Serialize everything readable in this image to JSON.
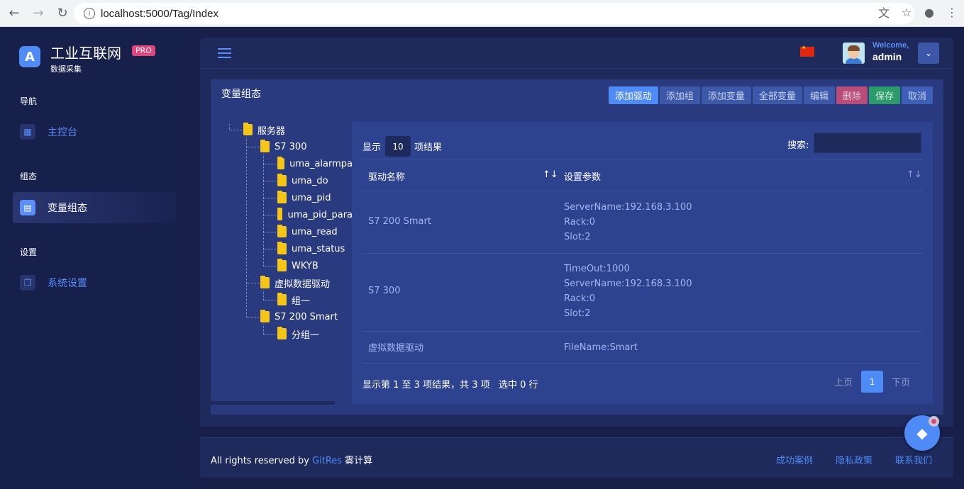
{
  "browser": {
    "url": "localhost:5000/Tag/Index"
  },
  "brand": {
    "title": "工业互联网",
    "subtitle": "数据采集",
    "badge": "PRO"
  },
  "sidebar": {
    "sections": [
      {
        "label": "导航"
      },
      {
        "label": "组态"
      },
      {
        "label": "设置"
      }
    ],
    "items": [
      {
        "label": "主控台",
        "icon": "dashboard-icon",
        "active": false
      },
      {
        "label": "变量组态",
        "icon": "window-icon",
        "active": true
      },
      {
        "label": "系统设置",
        "icon": "copy-icon",
        "active": false
      }
    ]
  },
  "topbar": {
    "welcome": "Welcome,",
    "username": "admin",
    "flag": "china-flag-icon"
  },
  "card": {
    "title": "变量组态",
    "toolbar": [
      "添加驱动",
      "添加组",
      "添加变量",
      "全部变量",
      "编辑",
      "删除",
      "保存",
      "取消"
    ]
  },
  "tree": {
    "nodes": [
      "服务器",
      "S7 300",
      "uma_alarmpa",
      "uma_do",
      "uma_pid",
      "uma_pid_para",
      "uma_read",
      "uma_status",
      "WKYB",
      "虚拟数据驱动",
      "组一",
      "S7 200 Smart",
      "分组一"
    ]
  },
  "table": {
    "show_prefix": "显示",
    "page_length": "10",
    "show_suffix": "项结果",
    "search_label": "搜索:",
    "columns": [
      "驱动名称",
      "设置参数"
    ],
    "rows": [
      {
        "name": "S7 200 Smart",
        "params": [
          "ServerName:192.168.3.100",
          "Rack:0",
          "Slot:2"
        ]
      },
      {
        "name": "S7 300",
        "params": [
          "TimeOut:1000",
          "ServerName:192.168.3.100",
          "Rack:0",
          "Slot:2"
        ]
      },
      {
        "name": "虚拟数据驱动",
        "params": [
          "FileName:Smart"
        ]
      }
    ],
    "info": "显示第 1 至 3 项结果，共 3 项",
    "selected": "选中 0 行",
    "pager": {
      "prev": "上页",
      "current": "1",
      "next": "下页"
    }
  },
  "footer": {
    "prefix": "All rights reserved by ",
    "link": "GitRes",
    "suffix": " 雾计算",
    "links": [
      "成功案例",
      "隐私政策",
      "联系我们"
    ]
  }
}
